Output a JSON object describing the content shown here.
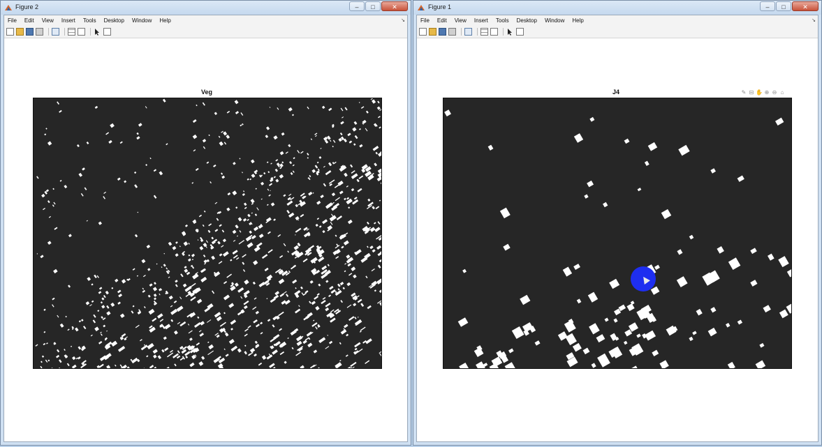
{
  "left_window": {
    "title": "Figure 2",
    "menu": [
      "File",
      "Edit",
      "View",
      "Insert",
      "Tools",
      "Desktop",
      "Window",
      "Help"
    ],
    "plot_title": "Veg"
  },
  "right_window": {
    "title": "Figure 1",
    "menu": [
      "File",
      "Edit",
      "View",
      "Insert",
      "Tools",
      "Desktop",
      "Window",
      "Help"
    ],
    "plot_title": "J4"
  },
  "window_controls": {
    "minimize": "–",
    "maximize": "□",
    "close": "✕"
  },
  "menu_arrow": "↘",
  "axes_tools": [
    "✎",
    "⊟",
    "✋",
    "⊕",
    "⊖",
    "⌂"
  ],
  "colors": {
    "plot_background": "#262626",
    "plot_foreground": "#ffffff",
    "cursor_highlight": "#1e2ef0"
  }
}
